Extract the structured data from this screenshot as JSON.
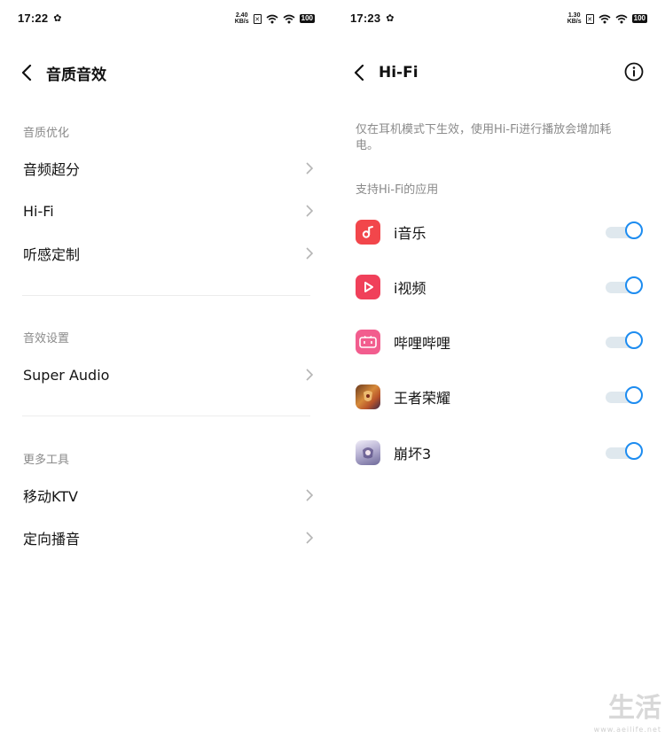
{
  "left": {
    "status": {
      "time": "17:22",
      "net_speed": "2.40",
      "net_unit": "KB/s",
      "battery": "100"
    },
    "title": "音质音效",
    "sections": [
      {
        "label": "音质优化",
        "items": [
          "音频超分",
          "Hi-Fi",
          "听感定制"
        ]
      },
      {
        "label": "音效设置",
        "items": [
          "Super Audio"
        ]
      },
      {
        "label": "更多工具",
        "items": [
          "移动KTV",
          "定向播音"
        ]
      }
    ]
  },
  "right": {
    "status": {
      "time": "17:23",
      "net_speed": "1.30",
      "net_unit": "KB/s",
      "battery": "100"
    },
    "title": "Hi-Fi",
    "description": "仅在耳机模式下生效，使用Hi-Fi进行播放会增加耗电。",
    "apps_label": "支持Hi-Fi的应用",
    "apps": [
      {
        "name": "i音乐",
        "icon": "music-app-icon",
        "color": "#f2464b",
        "enabled": true
      },
      {
        "name": "i视频",
        "icon": "video-app-icon",
        "color": "#f0405a",
        "enabled": true
      },
      {
        "name": "哔哩哔哩",
        "icon": "bilibili-app-icon",
        "color": "#f25d8e",
        "enabled": true
      },
      {
        "name": "王者荣耀",
        "icon": "game-app-icon",
        "color": "#b8532a",
        "enabled": true
      },
      {
        "name": "崩坏3",
        "icon": "game-app-icon",
        "color": "#8a7fb0",
        "enabled": true
      }
    ]
  },
  "colors": {
    "toggle_on": "#1d8cf0",
    "secondary_text": "#8a8a8a"
  },
  "watermark": {
    "main": "生活",
    "url": "www.aeilife.net"
  }
}
